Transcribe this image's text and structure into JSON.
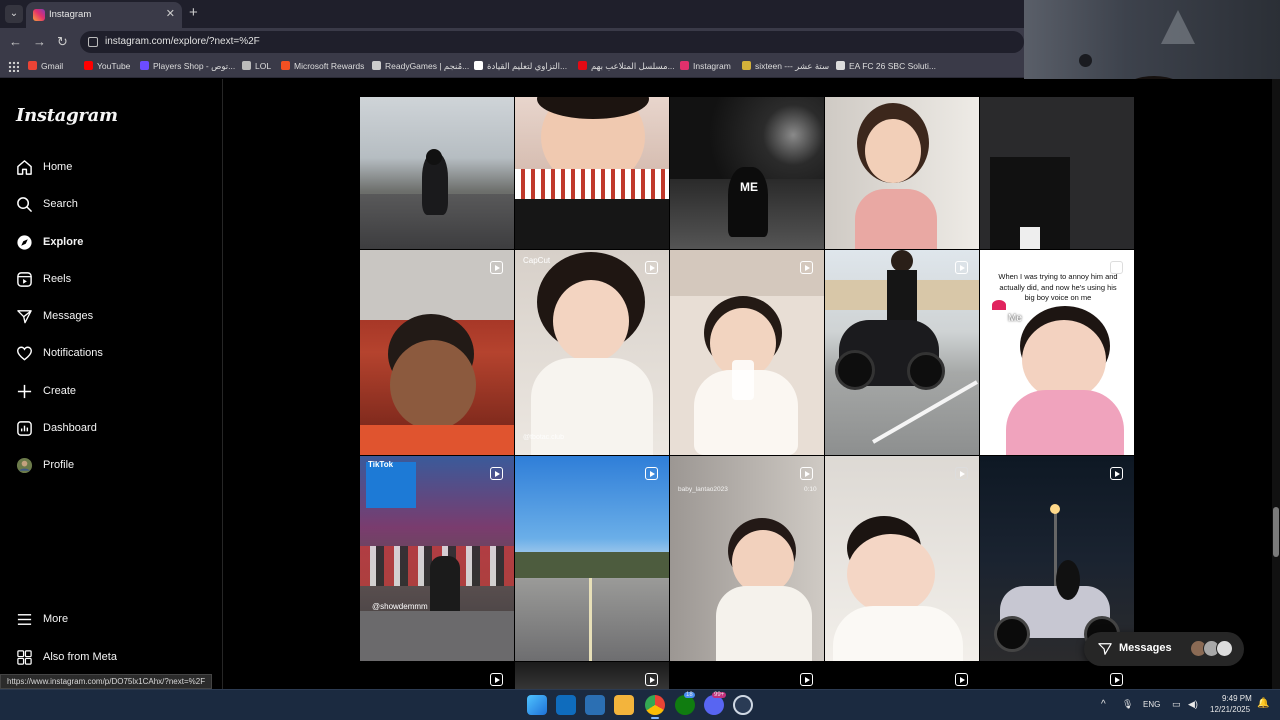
{
  "browser": {
    "tab_title": "Instagram",
    "url": "instagram.com/explore/?next=%2F",
    "status_url": "https://www.instagram.com/p/DO75lx1CAhx/?next=%2F",
    "bookmarks": [
      {
        "label": "Gmail",
        "icon": "gmail-icon",
        "color": "#ea4335"
      },
      {
        "label": "YouTube",
        "icon": "youtube-icon",
        "color": "#ff0000"
      },
      {
        "label": "Players Shop - توص...",
        "icon": "players-shop-icon",
        "color": "#6b4cff"
      },
      {
        "label": "LOL",
        "icon": "globe-icon",
        "color": "#bbbbbb"
      },
      {
        "label": "Microsoft Rewards",
        "icon": "microsoft-icon",
        "color": "#f25022"
      },
      {
        "label": "ReadyGames | مُنجم...",
        "icon": "readygames-icon",
        "color": "#cccccc"
      },
      {
        "label": "التزاوي لتعليم القيادة...",
        "icon": "driving-school-icon",
        "color": "#ffffff"
      },
      {
        "label": "مسلسل المتلاعب بهم...",
        "icon": "series-icon",
        "color": "#e50914"
      },
      {
        "label": "Instagram",
        "icon": "instagram-icon",
        "color": "#e1306c"
      },
      {
        "label": "sixteen --- ستة عشر",
        "icon": "sixteen-icon",
        "color": "#d4b13a"
      },
      {
        "label": "EA FC 26 SBC Soluti...",
        "icon": "ea-fc-icon",
        "color": "#dddddd"
      }
    ]
  },
  "sidebar": {
    "logo": "Instagram",
    "items": [
      {
        "label": "Home",
        "icon": "home-icon",
        "active": false
      },
      {
        "label": "Search",
        "icon": "search-icon",
        "active": false
      },
      {
        "label": "Explore",
        "icon": "compass-icon",
        "active": true
      },
      {
        "label": "Reels",
        "icon": "reels-icon",
        "active": false
      },
      {
        "label": "Messages",
        "icon": "messenger-icon",
        "active": false
      },
      {
        "label": "Notifications",
        "icon": "heart-icon",
        "active": false
      },
      {
        "label": "Create",
        "icon": "plus-icon",
        "active": false
      },
      {
        "label": "Dashboard",
        "icon": "dashboard-icon",
        "active": false
      },
      {
        "label": "Profile",
        "icon": "avatar-icon",
        "active": false
      }
    ],
    "bottom_items": [
      {
        "label": "More",
        "icon": "menu-icon"
      },
      {
        "label": "Also from Meta",
        "icon": "meta-icon"
      }
    ]
  },
  "grid": {
    "captions": {
      "me_overlay": "ME",
      "capcut": "CapCut",
      "watermark_1": "@tbotac.club",
      "meme_text": "When I was trying to annoy him and actually did, and now he's using his big boy voice on me",
      "meme_me": "Me",
      "tiktok": "TikTok",
      "tiktok_user": "@showdemmm",
      "baby_user": "baby_lantao2023",
      "baby_time": "0:10"
    }
  },
  "messages_pill": {
    "label": "Messages"
  },
  "taskbar": {
    "apps": [
      "windows-start-icon",
      "outlook-icon",
      "store-icon",
      "file-explorer-icon",
      "chrome-icon",
      "xbox-icon",
      "discord-icon",
      "steam-icon"
    ],
    "badges": {
      "xbox": "18",
      "discord": "99+"
    },
    "language": "ENG",
    "time": "9:49 PM",
    "date": "12/21/2025"
  }
}
